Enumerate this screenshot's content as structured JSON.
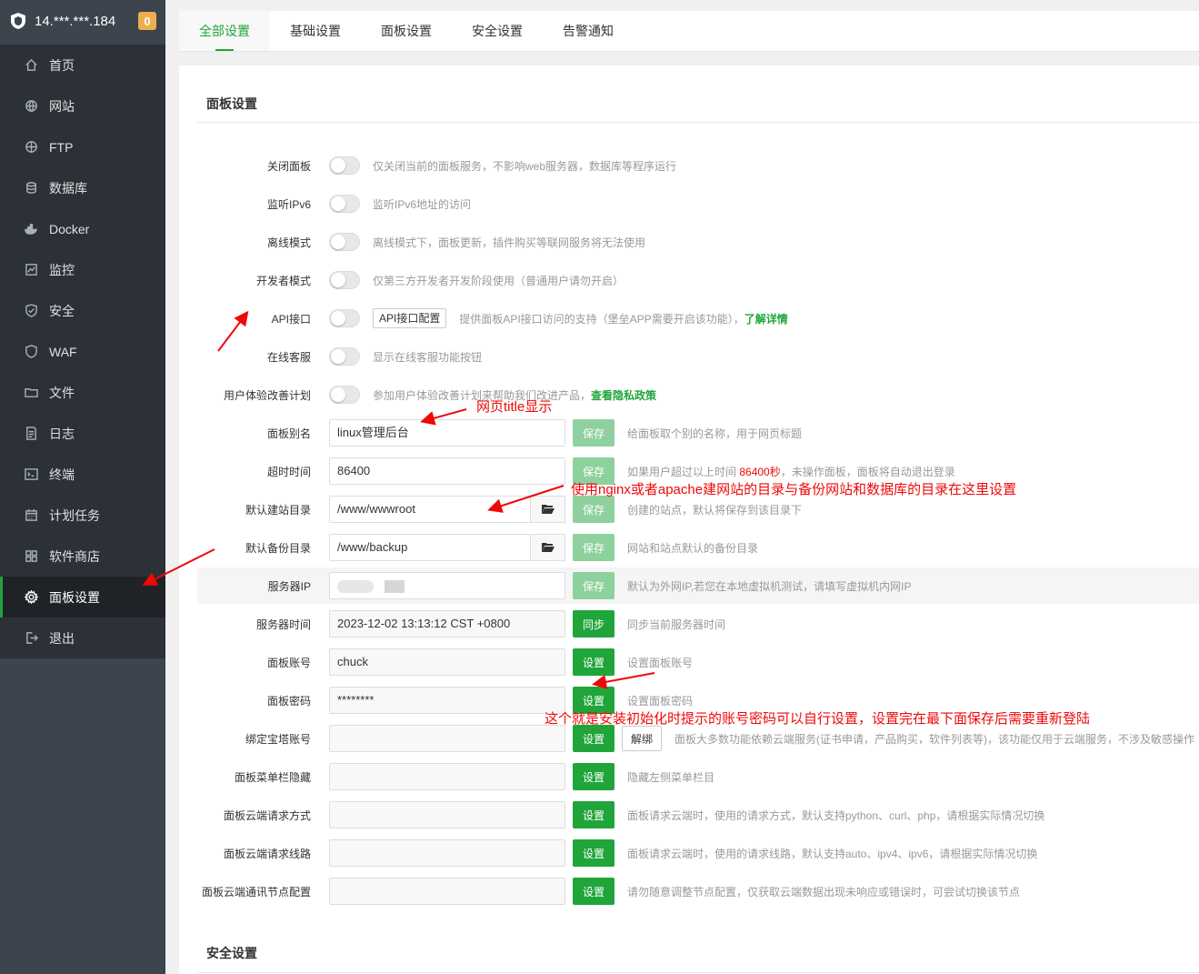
{
  "sidebar": {
    "server_ip": "14.***.***.184",
    "badge": "0",
    "items": [
      {
        "label": "首页",
        "icon": "home-icon"
      },
      {
        "label": "网站",
        "icon": "globe-icon"
      },
      {
        "label": "FTP",
        "icon": "ftp-globe-icon"
      },
      {
        "label": "数据库",
        "icon": "database-icon"
      },
      {
        "label": "Docker",
        "icon": "docker-icon"
      },
      {
        "label": "监控",
        "icon": "monitor-icon"
      },
      {
        "label": "安全",
        "icon": "shield-icon"
      },
      {
        "label": "WAF",
        "icon": "waf-icon"
      },
      {
        "label": "文件",
        "icon": "folder-icon"
      },
      {
        "label": "日志",
        "icon": "log-icon"
      },
      {
        "label": "终端",
        "icon": "terminal-icon"
      },
      {
        "label": "计划任务",
        "icon": "calendar-icon"
      },
      {
        "label": "软件商店",
        "icon": "grid-icon"
      },
      {
        "label": "面板设置",
        "icon": "gear-icon",
        "active": true
      },
      {
        "label": "退出",
        "icon": "logout-icon"
      }
    ]
  },
  "tabs": [
    "全部设置",
    "基础设置",
    "面板设置",
    "安全设置",
    "告警通知"
  ],
  "panel_section": {
    "title": "面板设置",
    "rows": {
      "close_panel": {
        "label": "关闭面板",
        "hint": "仅关闭当前的面板服务，不影响web服务器，数据库等程序运行"
      },
      "listen_ipv6": {
        "label": "监听IPv6",
        "hint": "监听IPv6地址的访问"
      },
      "offline_mode": {
        "label": "离线模式",
        "hint": "离线模式下，面板更新，插件购买等联网服务将无法使用"
      },
      "dev_mode": {
        "label": "开发者模式",
        "hint": "仅第三方开发者开发阶段使用（普通用户请勿开启）"
      },
      "api": {
        "label": "API接口",
        "button": "API接口配置",
        "hint": "提供面板API接口访问的支持（堡垒APP需要开启该功能），",
        "link": "了解详情"
      },
      "online_service": {
        "label": "在线客服",
        "hint": "显示在线客服功能按钮"
      },
      "ux_plan": {
        "label": "用户体验改善计划",
        "hint": "参加用户体验改善计划来帮助我们改进产品，",
        "link": "查看隐私政策"
      },
      "alias": {
        "label": "面板别名",
        "value": "linux管理后台",
        "button": "保存",
        "hint": "给面板取个别的名称，用于网页标题"
      },
      "timeout": {
        "label": "超时时间",
        "value": "86400",
        "button": "保存",
        "hint_a": "如果用户超过以上时间 ",
        "hint_red": "86400秒",
        "hint_b": "，未操作面板，面板将自动退出登录"
      },
      "site_dir": {
        "label": "默认建站目录",
        "value": "/www/wwwroot",
        "button": "保存",
        "hint": "创建的站点，默认将保存到该目录下"
      },
      "backup_dir": {
        "label": "默认备份目录",
        "value": "/www/backup",
        "button": "保存",
        "hint": "网站和站点默认的备份目录"
      },
      "server_ip": {
        "label": "服务器IP",
        "button": "保存",
        "hint": "默认为外网IP,若您在本地虚拟机测试，请填写虚拟机内网IP"
      },
      "server_time": {
        "label": "服务器时间",
        "value": "2023-12-02 13:13:12 CST +0800",
        "button": "同步",
        "hint": "同步当前服务器时间"
      },
      "account": {
        "label": "面板账号",
        "value": "chuck",
        "button": "设置",
        "hint": "设置面板账号"
      },
      "password": {
        "label": "面板密码",
        "value": "********",
        "button": "设置",
        "hint": "设置面板密码"
      },
      "bind_bt": {
        "label": "绑定宝塔账号",
        "button": "设置",
        "button2": "解绑",
        "hint": "面板大多数功能依赖云端服务(证书申请，产品购买，软件列表等)，该功能仅用于云端服务，不涉及敏感操作"
      },
      "hide_menu": {
        "label": "面板菜单栏隐藏",
        "button": "设置",
        "hint": "隐藏左侧菜单栏目"
      },
      "cloud_method": {
        "label": "面板云端请求方式",
        "button": "设置",
        "hint": "面板请求云端时，使用的请求方式，默认支持python、curl、php，请根据实际情况切换"
      },
      "cloud_route": {
        "label": "面板云端请求线路",
        "button": "设置",
        "hint": "面板请求云端时，使用的请求线路，默认支持auto、ipv4、ipv6，请根据实际情况切换"
      },
      "cloud_node": {
        "label": "面板云端通讯节点配置",
        "button": "设置",
        "hint": "请勿随意调整节点配置，仅获取云端数据出现未响应或错误时，可尝试切换该节点"
      }
    }
  },
  "security_section": {
    "title": "安全设置"
  },
  "annotations": {
    "title_note": "网页title显示",
    "dir_note": "使用nginx或者apache建网站的目录与备份网站和数据库的目录在这里设置",
    "account_note": "这个就是安装初始化时提示的账号密码可以自行设置，设置完在最下面保存后需要重新登陆"
  },
  "colors": {
    "accent": "#20a53a",
    "sidebar_bg": "#3c444d",
    "annotation": "#ef0808"
  }
}
